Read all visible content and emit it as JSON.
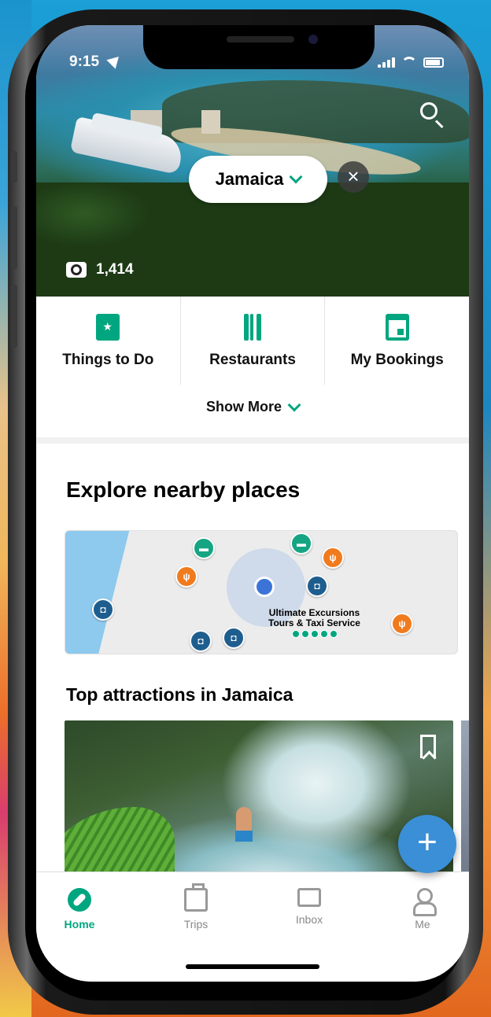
{
  "status_bar": {
    "time": "9:15"
  },
  "location": {
    "name": "Jamaica"
  },
  "hero": {
    "photo_count": "1,414"
  },
  "categories": [
    {
      "label": "Things to Do",
      "icon": "ticket-icon"
    },
    {
      "label": "Restaurants",
      "icon": "fork-knife-icon"
    },
    {
      "label": "My Bookings",
      "icon": "calendar-icon"
    }
  ],
  "show_more": "Show More",
  "explore": {
    "title": "Explore nearby places",
    "map_place_name_line1": "Ultimate Excursions",
    "map_place_name_line2": "Tours & Taxi Service",
    "map_place_rating": 5
  },
  "attractions": {
    "title": "Top attractions in Jamaica"
  },
  "tabs": [
    {
      "label": "Home",
      "icon": "compass-icon",
      "active": true
    },
    {
      "label": "Trips",
      "icon": "suitcase-icon",
      "active": false
    },
    {
      "label": "Inbox",
      "icon": "chat-icon",
      "active": false
    },
    {
      "label": "Me",
      "icon": "person-icon",
      "active": false
    }
  ],
  "colors": {
    "accent": "#00a680",
    "fab": "#3a8fd6",
    "food_pin": "#f07b1e",
    "attraction_pin": "#1e5e8f"
  }
}
